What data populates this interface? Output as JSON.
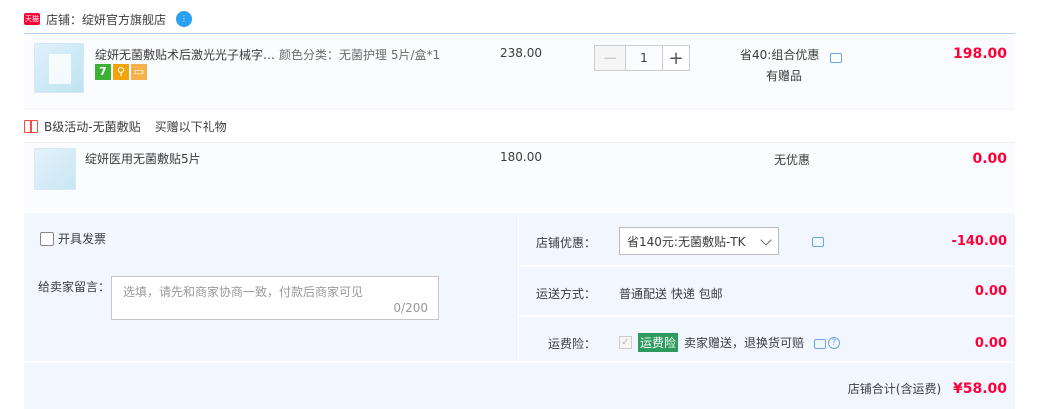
{
  "shop": {
    "badge": "天猫",
    "name": "店铺：绽妍官方旗舰店"
  },
  "items": [
    {
      "title": "绽妍无菌敷贴术后激光光子械字…",
      "sku": "颜色分类：无菌护理 5片/盒*1",
      "price": "238.00",
      "quantity": "1",
      "discount_line1": "省40:组合优惠",
      "discount_line2": "有赠品",
      "subtotal": "198.00"
    },
    {
      "title": "绽妍医用无菌敷贴5片",
      "price": "180.00",
      "discount_line1": "无优惠",
      "subtotal": "0.00"
    }
  ],
  "gift_row": {
    "activity": "B级活动-无菌敷贴",
    "desc": "买赠以下礼物"
  },
  "invoice": {
    "label": "开具发票"
  },
  "memo": {
    "label": "给卖家留言：",
    "placeholder": "选填，请先和商家协商一致，付款后商家可见",
    "counter": "0/200"
  },
  "shop_discount": {
    "label": "店铺优惠：",
    "selected": "省140元:无菌敷贴-TK",
    "amount": "-140.00"
  },
  "shipping": {
    "label": "运送方式：",
    "value": "普通配送 快递 包邮",
    "amount": "0.00"
  },
  "insurance": {
    "label": "运费险：",
    "badge": "运费险",
    "text": "卖家赠送，退换货可赔",
    "amount": "0.00"
  },
  "total": {
    "label": "店铺合计(含运费)",
    "value": "¥58.00"
  },
  "colors": {
    "accent": "#ff0036",
    "border_blue": "#b2d1ff",
    "panel": "#f2f7ff",
    "insurance_green": "#2d9b5e"
  }
}
